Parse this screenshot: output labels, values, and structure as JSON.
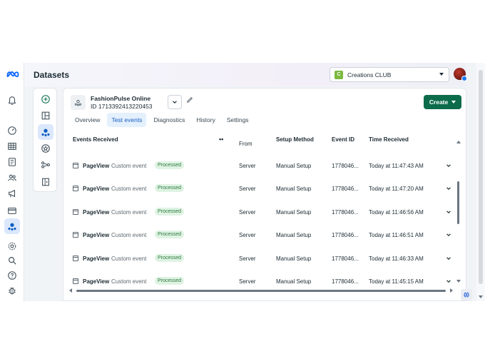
{
  "header": {
    "title": "Datasets",
    "account": {
      "badge": "C",
      "name": "Creations CLUB"
    }
  },
  "global_nav": {
    "icons": [
      "meta-logo-icon",
      "bell-icon",
      "dashboard-icon",
      "table-icon",
      "catalog-icon",
      "people-icon",
      "megaphone-icon",
      "credit-card-icon",
      "events-manager-icon",
      "settings-icon",
      "search-icon",
      "help-icon",
      "bug-icon"
    ]
  },
  "tools_rail": {
    "icons": [
      "add-icon",
      "layout-icon",
      "data-sources-icon",
      "star-icon",
      "integration-icon",
      "partner-icon"
    ]
  },
  "dataset": {
    "name": "FashionPulse Online",
    "id": "ID 1713392413220453"
  },
  "create_button": {
    "label": "Create"
  },
  "tabs": [
    {
      "label": "Overview",
      "active": false
    },
    {
      "label": "Test events",
      "active": true
    },
    {
      "label": "Diagnostics",
      "active": false
    },
    {
      "label": "History",
      "active": false
    },
    {
      "label": "Settings",
      "active": false
    }
  ],
  "table": {
    "headers": {
      "events_received": "Events Received",
      "from": "From",
      "setup_method": "Setup Method",
      "event_id": "Event ID",
      "time_received": "Time Received"
    },
    "rows": [
      {
        "name": "PageView",
        "type": "Custom event",
        "status": "Processed",
        "from": "Server",
        "setup": "Manual Setup",
        "event_id": "1778046...",
        "time": "Today at 11:47:43 AM"
      },
      {
        "name": "PageView",
        "type": "Custom event",
        "status": "Processed",
        "from": "Server",
        "setup": "Manual Setup",
        "event_id": "1778046...",
        "time": "Today at 11:47:20 AM"
      },
      {
        "name": "PageView",
        "type": "Custom event",
        "status": "Processed",
        "from": "Server",
        "setup": "Manual Setup",
        "event_id": "1778046...",
        "time": "Today at 11:46:56 AM"
      },
      {
        "name": "PageView",
        "type": "Custom event",
        "status": "Processed",
        "from": "Server",
        "setup": "Manual Setup",
        "event_id": "1778046...",
        "time": "Today at 11:46:51 AM"
      },
      {
        "name": "PageView",
        "type": "Custom event",
        "status": "Processed",
        "from": "Server",
        "setup": "Manual Setup",
        "event_id": "1778046...",
        "time": "Today at 11:46:33 AM"
      },
      {
        "name": "PageView",
        "type": "Custom event",
        "status": "Processed",
        "from": "Server",
        "setup": "Manual Setup",
        "event_id": "1778046...",
        "time": "Today at 11:45:15 AM"
      }
    ]
  },
  "colors": {
    "create_button": "#0b6b4a",
    "active_tab_bg": "#e5f0fd",
    "processed_badge_bg": "#dff3e3",
    "processed_badge_text": "#2b7a3d",
    "meta_blue": "#0866ff"
  }
}
